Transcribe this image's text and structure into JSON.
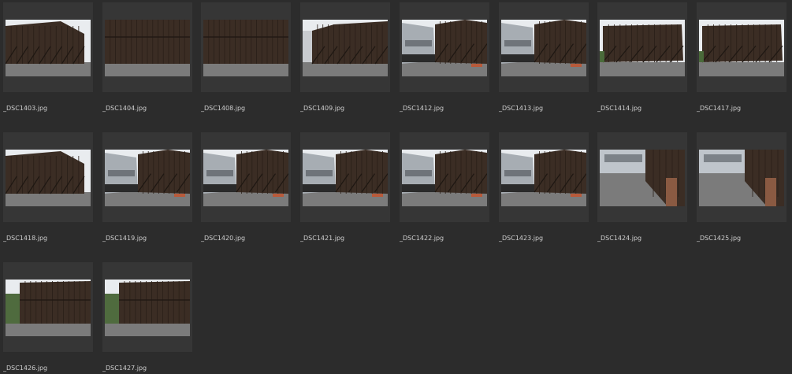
{
  "browser": {
    "items": [
      {
        "filename": "_DSC1403.jpg"
      },
      {
        "filename": "_DSC1404.jpg"
      },
      {
        "filename": "_DSC1408.jpg"
      },
      {
        "filename": "_DSC1409.jpg"
      },
      {
        "filename": "_DSC1412.jpg"
      },
      {
        "filename": "_DSC1413.jpg"
      },
      {
        "filename": "_DSC1414.jpg"
      },
      {
        "filename": "_DSC1417.jpg"
      },
      {
        "filename": "_DSC1418.jpg"
      },
      {
        "filename": "_DSC1419.jpg"
      },
      {
        "filename": "_DSC1420.jpg"
      },
      {
        "filename": "_DSC1421.jpg"
      },
      {
        "filename": "_DSC1422.jpg"
      },
      {
        "filename": "_DSC1423.jpg"
      },
      {
        "filename": "_DSC1424.jpg"
      },
      {
        "filename": "_DSC1425.jpg"
      },
      {
        "filename": "_DSC1426.jpg"
      },
      {
        "filename": "_DSC1427.jpg"
      }
    ]
  },
  "colors": {
    "background": "#2c2c2c",
    "cell": "#363636",
    "label": "#cfcfcf",
    "sky": "#e9ecef",
    "barn": "#3b2d24",
    "ground": "#7b7b7b",
    "shed": "#a7adb3"
  }
}
